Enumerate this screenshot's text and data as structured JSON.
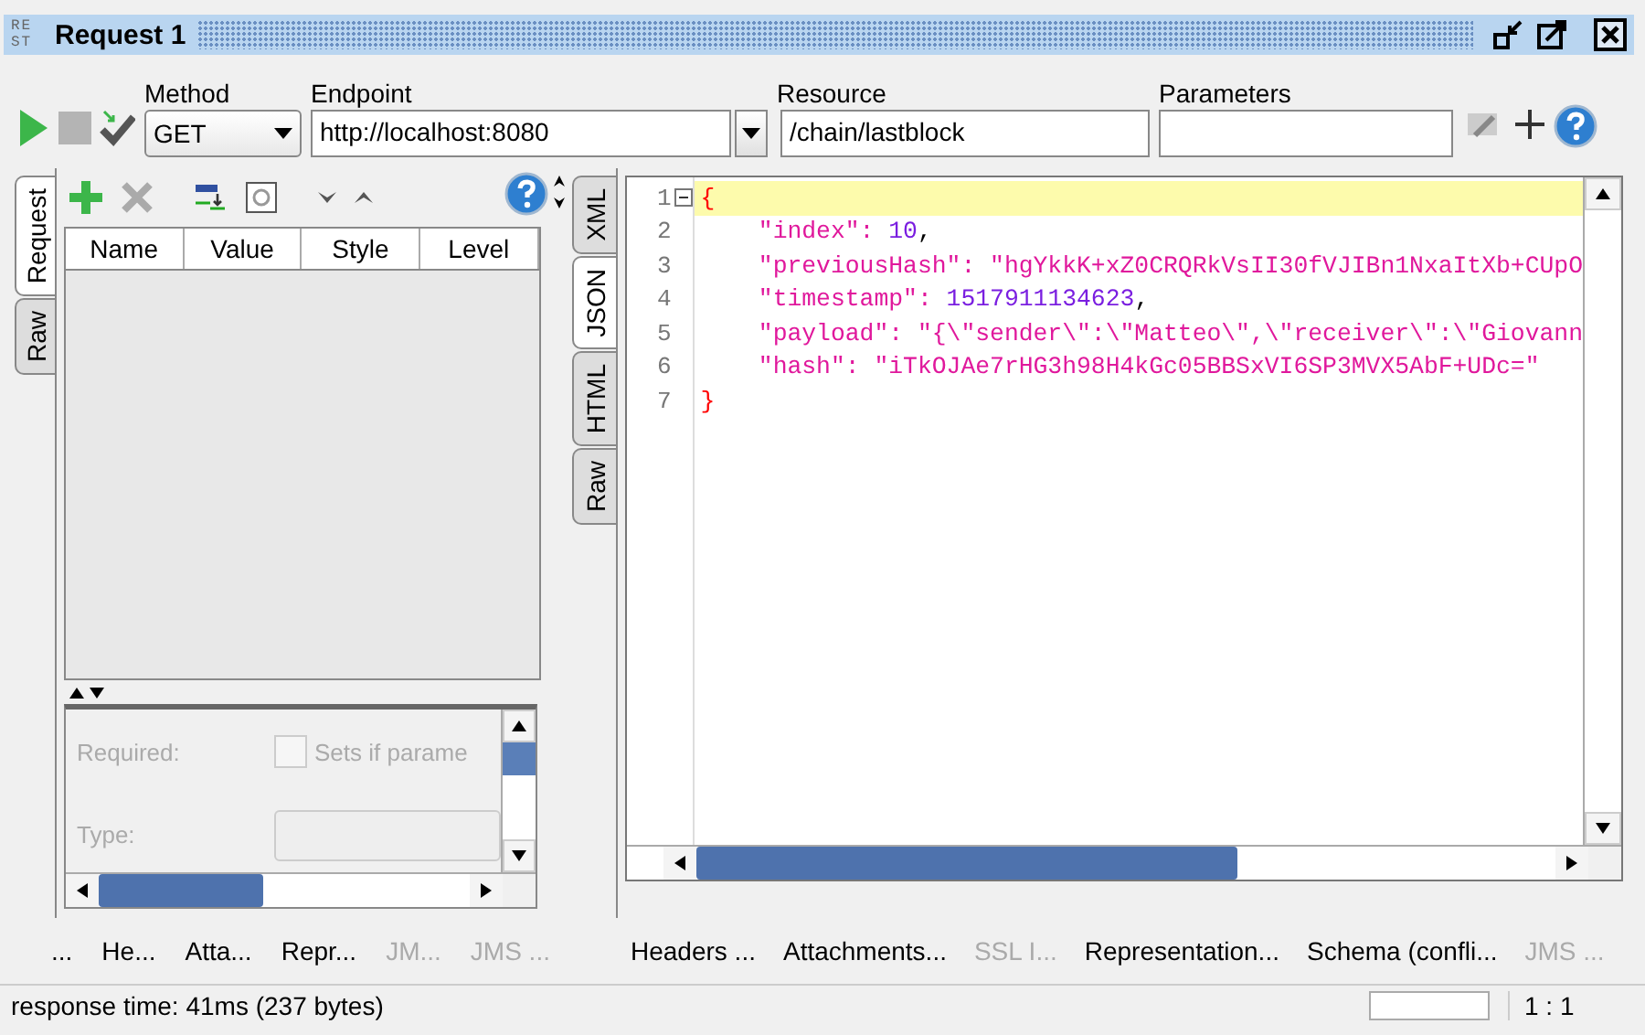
{
  "window": {
    "title": "Request 1",
    "logo": "RE ST"
  },
  "toolbar": {
    "method": {
      "label": "Method",
      "value": "GET"
    },
    "endpoint": {
      "label": "Endpoint",
      "value": "http://localhost:8080"
    },
    "resource": {
      "label": "Resource",
      "value": "/chain/lastblock"
    },
    "parameters": {
      "label": "Parameters"
    }
  },
  "request_panel": {
    "tabs": [
      {
        "label": "Request",
        "selected": true
      },
      {
        "label": "Raw",
        "selected": false
      }
    ],
    "table": {
      "columns": [
        "Name",
        "Value",
        "Style",
        "Level"
      ]
    },
    "properties": {
      "required_label": "Required:",
      "checkbox": {
        "label": "Sets if parame",
        "checked": false
      },
      "type_label": "Type:"
    },
    "bottom_tabs": [
      {
        "label": "...",
        "disabled": false
      },
      {
        "label": "He...",
        "disabled": false
      },
      {
        "label": "Atta...",
        "disabled": false
      },
      {
        "label": "Repr...",
        "disabled": false
      },
      {
        "label": "JM...",
        "disabled": true
      },
      {
        "label": "JMS ...",
        "disabled": true
      }
    ]
  },
  "response_panel": {
    "tabs": [
      {
        "label": "XML",
        "selected": false
      },
      {
        "label": "JSON",
        "selected": true
      },
      {
        "label": "HTML",
        "selected": false
      },
      {
        "label": "Raw",
        "selected": false
      }
    ],
    "editor": {
      "lines": [
        {
          "number": "1",
          "current": true,
          "tokens": [
            {
              "kind": "bracket",
              "text": "{"
            }
          ]
        },
        {
          "number": "2",
          "current": false,
          "tokens": [
            {
              "kind": "key",
              "text": "    \"index\": "
            },
            {
              "kind": "number",
              "text": "10"
            },
            {
              "kind": "punct",
              "text": ","
            }
          ]
        },
        {
          "number": "3",
          "current": false,
          "tokens": [
            {
              "kind": "key",
              "text": "    \"previousHash\": \"hgYkkK+xZ0CRQRkVsII30fVJIBn1NxaItXb+CUpO"
            }
          ]
        },
        {
          "number": "4",
          "current": false,
          "tokens": [
            {
              "kind": "key",
              "text": "    \"timestamp\": "
            },
            {
              "kind": "number",
              "text": "1517911134623"
            },
            {
              "kind": "punct",
              "text": ","
            }
          ]
        },
        {
          "number": "5",
          "current": false,
          "tokens": [
            {
              "kind": "key",
              "text": "    \"payload\": \"{\\\"sender\\\":\\\"Matteo\\\",\\\"receiver\\\":\\\"Giovann"
            }
          ]
        },
        {
          "number": "6",
          "current": false,
          "tokens": [
            {
              "kind": "key",
              "text": "    \"hash\": \"iTkOJAe7rHG3h98H4kGc05BBSxVI6SP3MVX5AbF+UDc=\""
            }
          ]
        },
        {
          "number": "7",
          "current": false,
          "tokens": [
            {
              "kind": "bracket",
              "text": "}"
            }
          ]
        }
      ]
    },
    "bottom_tabs": [
      {
        "label": "Headers ...",
        "disabled": false
      },
      {
        "label": "Attachments...",
        "disabled": false
      },
      {
        "label": "SSL I...",
        "disabled": true
      },
      {
        "label": "Representation...",
        "disabled": false
      },
      {
        "label": "Schema (confli...",
        "disabled": false
      },
      {
        "label": "JMS ...",
        "disabled": true
      }
    ]
  },
  "status_bar": {
    "message": "response time: 41ms (237 bytes)",
    "position": "1 : 1"
  }
}
